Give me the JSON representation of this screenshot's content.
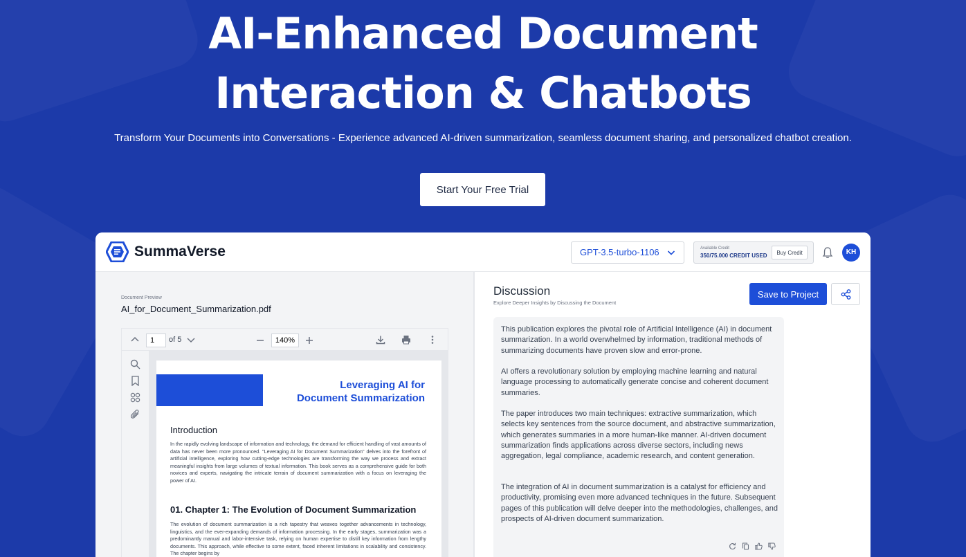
{
  "hero": {
    "title_line1": "AI-Enhanced Document",
    "title_line2": "Interaction & Chatbots",
    "subtitle": "Transform Your Documents into Conversations - Experience advanced AI-driven summarization, seamless document sharing, and personalized chatbot creation.",
    "cta_label": "Start Your Free Trial"
  },
  "app": {
    "brand": "SummaVerse",
    "model": "GPT-3.5-turbo-1106",
    "credit": {
      "label": "Available Credit",
      "value": "350/75.000 CREDIT USED",
      "buy_label": "Buy Credit"
    },
    "avatar_initials": "KH",
    "colors": {
      "accent": "#1d4ed8",
      "background": "#1c3aa9"
    }
  },
  "document": {
    "label": "Document Preview",
    "filename": "AI_for_Document_Summarization.pdf",
    "viewer": {
      "page": "1",
      "of_pages": "of 5",
      "zoom": "140%"
    },
    "page": {
      "title_line1": "Leveraging AI for",
      "title_line2": "Document Summarization",
      "heading1": "Introduction",
      "para1": "In the rapidly evolving landscape of information and technology, the demand for efficient handling of vast amounts of data has never been more pronounced. \"Leveraging AI for Document Summarization\" delves into the forefront of artificial intelligence, exploring how cutting-edge technologies are transforming the way we process and extract meaningful insights from large volumes of textual information. This book serves as a comprehensive guide for both novices and experts, navigating the intricate terrain of document summarization with a focus on leveraging the power of AI.",
      "heading2": "01.   Chapter 1: The Evolution of Document Summarization",
      "para2": "The evolution of document summarization is a rich tapestry that weaves together advancements in technology, linguistics, and the ever-expanding demands of information processing. In the early stages, summarization was a predominantly manual and labor-intensive task, relying on human expertise to distill key information from lengthy documents. This approach, while effective to some extent, faced inherent limitations in scalability and consistency. The chapter begins by"
    }
  },
  "discussion": {
    "title": "Discussion",
    "subtitle": "Explore Deeper Insights by Discussing the Document",
    "save_label": "Save to Project",
    "message": {
      "p1": "This publication explores the pivotal role of Artificial Intelligence (AI) in document summarization. In a world overwhelmed by information, traditional methods of summarizing documents have proven slow and error-prone.",
      "p2": "AI offers a revolutionary solution by employing machine learning and natural language processing to automatically generate concise and coherent document summaries.",
      "p3": "The paper introduces two main techniques: extractive summarization, which selects key sentences from the source document, and abstractive summarization, which generates summaries in a more human-like manner. AI-driven document summarization finds applications across diverse sectors, including news aggregation, legal compliance, academic research, and content generation.",
      "p4": "The integration of AI in document summarization is a catalyst for efficiency and productivity, promising even more advanced techniques in the future. Subsequent pages of this publication will delve deeper into the methodologies, challenges, and prospects of AI-driven document summarization."
    }
  }
}
